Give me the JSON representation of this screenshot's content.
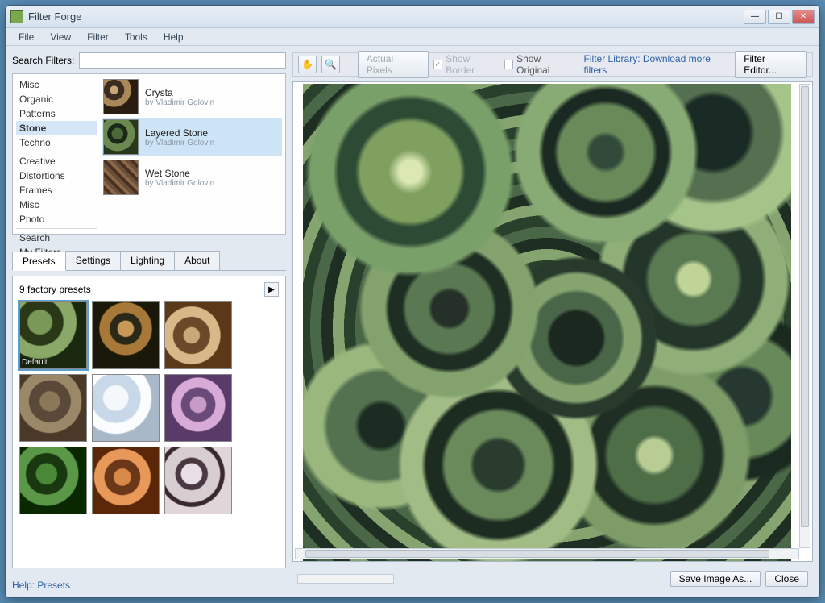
{
  "app": {
    "title": "Filter Forge"
  },
  "menubar": [
    "File",
    "View",
    "Filter",
    "Tools",
    "Help"
  ],
  "search": {
    "label": "Search Filters:",
    "value": ""
  },
  "categories": {
    "group1": [
      "Misc",
      "Organic",
      "Patterns",
      "Stone",
      "Techno"
    ],
    "group2": [
      "Creative",
      "Distortions",
      "Frames",
      "Misc",
      "Photo"
    ],
    "group3": [
      "Search",
      "My Filters"
    ],
    "selected": "Stone"
  },
  "filters": [
    {
      "name": "Crysta",
      "author": "by Vladimir Golovin",
      "thumbClass": "crysta"
    },
    {
      "name": "Layered Stone",
      "author": "by Vladimir Golovin",
      "thumbClass": "layered"
    },
    {
      "name": "Wet Stone",
      "author": "by Vladimir Golovin",
      "thumbClass": "wet"
    }
  ],
  "filters_selected_index": 1,
  "tabs": [
    "Presets",
    "Settings",
    "Lighting",
    "About"
  ],
  "tabs_active": "Presets",
  "presets": {
    "header": "9 factory presets",
    "items": [
      "Default",
      "",
      "",
      "",
      "",
      "",
      "",
      "",
      ""
    ],
    "selected_index": 0
  },
  "help_link": "Help: Presets",
  "toolbar": {
    "actual_pixels": "Actual Pixels",
    "show_border": "Show Border",
    "show_original": "Show Original",
    "library_link": "Filter Library: Download more filters",
    "filter_editor": "Filter Editor..."
  },
  "bottombar": {
    "save_image": "Save Image As...",
    "close": "Close"
  }
}
